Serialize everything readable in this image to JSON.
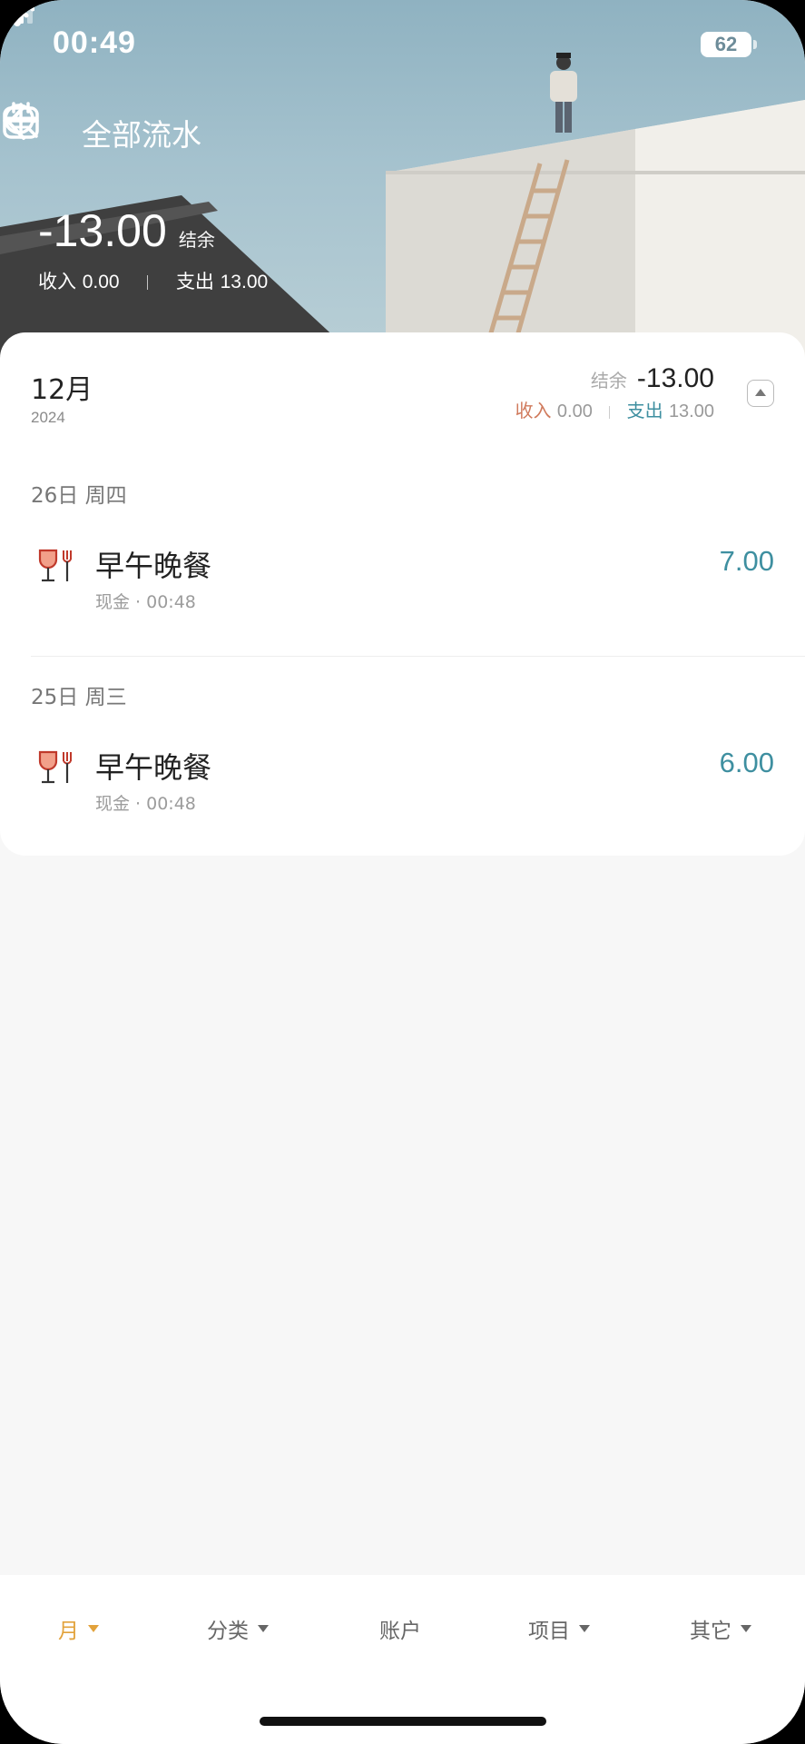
{
  "status_bar": {
    "time": "00:49",
    "battery": "62"
  },
  "nav": {
    "title": "全部流水"
  },
  "summary": {
    "balance": "-13.00",
    "balance_label": "结余",
    "income_label": "收入",
    "income_value": "0.00",
    "expense_label": "支出",
    "expense_value": "13.00"
  },
  "month": {
    "title": "12月",
    "year": "2024",
    "balance_label": "结余",
    "balance": "-13.00",
    "income_label": "收入",
    "income_value": "0.00",
    "expense_label": "支出",
    "expense_value": "13.00"
  },
  "days": [
    {
      "header": "26日  周四",
      "entries": [
        {
          "name": "早午晚餐",
          "meta": "现金 · 00:48",
          "amount": "7.00",
          "icon": "dining-icon"
        }
      ]
    },
    {
      "header": "25日  周三",
      "entries": [
        {
          "name": "早午晚餐",
          "meta": "现金 · 00:48",
          "amount": "6.00",
          "icon": "dining-icon"
        }
      ]
    }
  ],
  "tabs": [
    {
      "label": "月",
      "dropdown": true,
      "active": true
    },
    {
      "label": "分类",
      "dropdown": true,
      "active": false
    },
    {
      "label": "账户",
      "dropdown": false,
      "active": false
    },
    {
      "label": "项目",
      "dropdown": true,
      "active": false
    },
    {
      "label": "其它",
      "dropdown": true,
      "active": false
    }
  ],
  "colors": {
    "accent_tab": "#e2a23b",
    "income": "#d07a5c",
    "expense": "#3e8fa0"
  }
}
